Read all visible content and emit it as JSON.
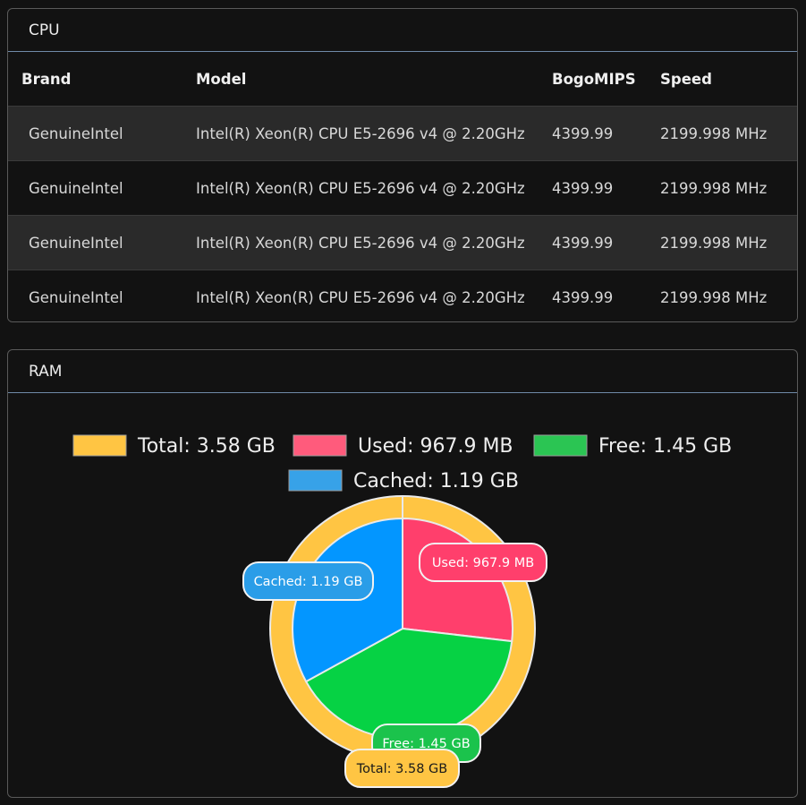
{
  "cpu": {
    "title": "CPU",
    "columns": [
      "Brand",
      "Model",
      "BogoMIPS",
      "Speed"
    ],
    "rows": [
      [
        "GenuineIntel",
        "Intel(R) Xeon(R) CPU E5-2696 v4 @ 2.20GHz",
        "4399.99",
        "2199.998 MHz"
      ],
      [
        "GenuineIntel",
        "Intel(R) Xeon(R) CPU E5-2696 v4 @ 2.20GHz",
        "4399.99",
        "2199.998 MHz"
      ],
      [
        "GenuineIntel",
        "Intel(R) Xeon(R) CPU E5-2696 v4 @ 2.20GHz",
        "4399.99",
        "2199.998 MHz"
      ],
      [
        "GenuineIntel",
        "Intel(R) Xeon(R) CPU E5-2696 v4 @ 2.20GHz",
        "4399.99",
        "2199.998 MHz"
      ]
    ]
  },
  "ram": {
    "title": "RAM"
  },
  "chart_data": {
    "type": "pie",
    "series": [
      {
        "ring": "outer",
        "categories": [
          "Total: 3.58 GB"
        ],
        "values": [
          3.58
        ],
        "colors": [
          "#ffc543"
        ]
      },
      {
        "ring": "inner",
        "categories": [
          "Used: 967.9 MB",
          "Free: 1.45 GB",
          "Cached: 1.19 GB"
        ],
        "values": [
          0.9679,
          1.45,
          1.19
        ],
        "colors": [
          "#ff3f6c",
          "#06d244",
          "#0396ff"
        ]
      }
    ],
    "legend": [
      {
        "label": "Total: 3.58 GB",
        "color": "#ffc543"
      },
      {
        "label": "Used: 967.9 MB",
        "color": "#ff5b7c"
      },
      {
        "label": "Free: 1.45 GB",
        "color": "#2bc553"
      },
      {
        "label": "Cached: 1.19 GB",
        "color": "#37a2e8"
      }
    ],
    "legend_position": "top",
    "data_labels": [
      "Used: 967.9 MB",
      "Cached: 1.19 GB",
      "Free: 1.45 GB",
      "Total: 3.58 GB"
    ]
  }
}
